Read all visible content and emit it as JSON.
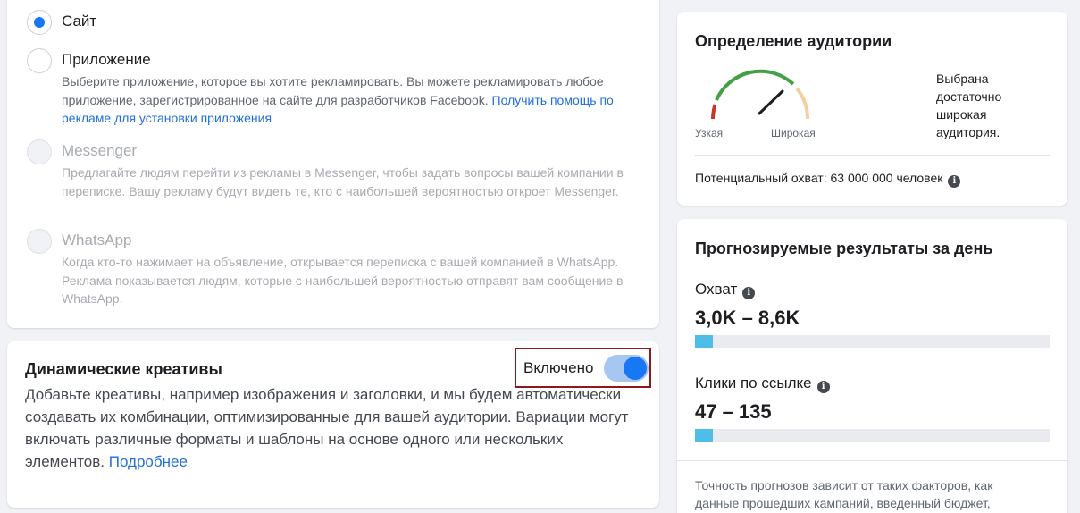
{
  "destination": {
    "options": [
      {
        "title": "Сайт",
        "checked": true,
        "disabled": false
      },
      {
        "title": "Приложение",
        "checked": false,
        "disabled": false,
        "desc": "Выберите приложение, которое вы хотите рекламировать. Вы можете рекламировать любое приложение, зарегистрированное на сайте для разработчиков Facebook.",
        "link": "Получить помощь по рекламе для установки приложения"
      },
      {
        "title": "Messenger",
        "checked": false,
        "disabled": true,
        "desc": "Предлагайте людям перейти из рекламы в Messenger, чтобы задать вопросы вашей компании в переписке. Вашу рекламу будут видеть те, кто с наибольшей вероятностью откроет Messenger."
      },
      {
        "title": "WhatsApp",
        "checked": false,
        "disabled": true,
        "desc": "Когда кто-то нажимает на объявление, открывается переписка с вашей компанией в WhatsApp. Реклама показывается людям, которые с наибольшей вероятностью отправят вам сообщение в WhatsApp."
      }
    ]
  },
  "dynamic": {
    "title": "Динамические креативы",
    "toggle_label": "Включено",
    "toggle_on": true,
    "desc": "Добавьте креативы, например изображения и заголовки, и мы будем автоматически создавать их комбинации, оптимизированные для вашей аудитории. Вариации могут включать различные форматы и шаблоны на основе одного или нескольких элементов.",
    "link": "Подробнее"
  },
  "audience": {
    "title": "Определение аудитории",
    "narrow_label": "Узкая",
    "broad_label": "Широкая",
    "status": "Выбрана достаточно широкая аудитория.",
    "reach": "Потенциальный охват: 63 000 000 человек",
    "info_icon": "i"
  },
  "results": {
    "title": "Прогнозируемые результаты за день",
    "reach_label": "Охват",
    "reach_value": "3,0K – 8,6K",
    "reach_fill": 0.05,
    "clicks_label": "Клики по ссылке",
    "clicks_value": "47 – 135",
    "clicks_fill": 0.05,
    "info_icon": "i",
    "footnote": "Точность прогнозов зависит от таких факторов, как данные прошедших кампаний, введенный бюджет,"
  },
  "colors": {
    "accent": "#1877f2",
    "link": "#216fdb",
    "bar_fill": "#4ebde8",
    "toggle_border": "#8b1a1a"
  }
}
